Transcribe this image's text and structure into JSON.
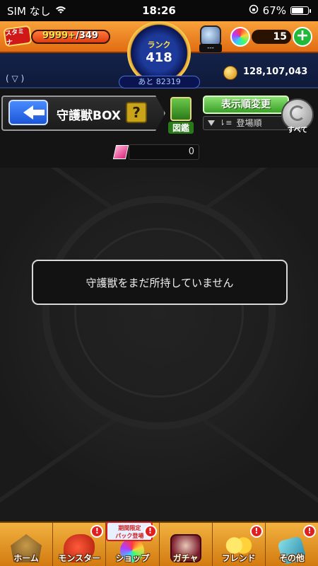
{
  "status_bar": {
    "carrier": "SIM なし",
    "time": "18:26",
    "battery": "67%"
  },
  "hud": {
    "stamina_label": "スタミナ",
    "stamina_current": "9999+",
    "stamina_max": "/349",
    "stamina_fill_fraction": 1.0,
    "rank_label": "ランク",
    "rank_value": "418",
    "rank_next": "あと 82319",
    "item_count": "---",
    "orb_count": "15",
    "orb_add": "+",
    "dropdown_indicator": "(  ▽  )",
    "coins": "128,107,043"
  },
  "title_row": {
    "page_title": "守護獣BOX",
    "help": "?",
    "dex_label": "図鑑",
    "sort_button": "表示順変更",
    "sort_current": "登場順",
    "all_label": "すべて"
  },
  "count_row": {
    "count": "0"
  },
  "main": {
    "empty_message": "守護獣をまだ所持していません"
  },
  "bottom_nav": {
    "items": [
      {
        "label": "ホーム",
        "icon": "home-icon",
        "alert": ""
      },
      {
        "label": "モンスター",
        "icon": "monster-icon",
        "alert": "!"
      },
      {
        "label": "ショップ",
        "icon": "shop-icon",
        "alert": "!",
        "promo": "期間限定\nパック登場"
      },
      {
        "label": "ガチャ",
        "icon": "gacha-icon",
        "alert": ""
      },
      {
        "label": "フレンド",
        "icon": "friend-icon",
        "alert": "!"
      },
      {
        "label": "その他",
        "icon": "other-icon",
        "alert": "!"
      }
    ]
  },
  "colors": {
    "hud_orange": "#f8a23a",
    "hud_blue": "#1a2a58",
    "nav_orange": "#f2b240",
    "sort_green": "#3aa028",
    "back_blue": "#1c56d8"
  }
}
